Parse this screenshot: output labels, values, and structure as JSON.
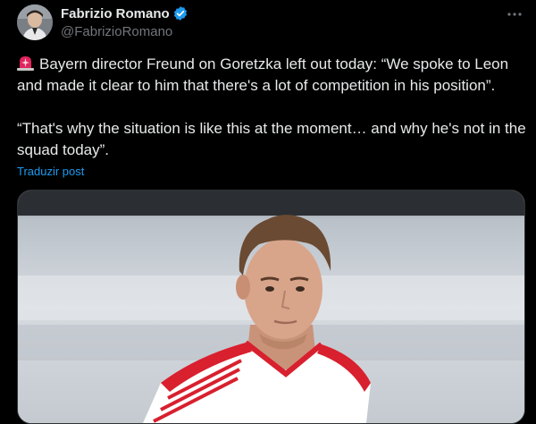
{
  "author": {
    "name": "Fabrizio Romano",
    "handle": "@FabrizioRomano",
    "verified_icon": "verified-badge-icon",
    "avatar_icon": "avatar"
  },
  "more_icon": "more-options-icon",
  "tweet": {
    "emoji": "rotating-light-emoji",
    "paragraph1": "Bayern director Freund on Goretzka left out today: “We spoke to Leon and made it clear to him that there's a lot of competition in his position”.",
    "paragraph2": "“That's why the situation is like this at the moment… and why he's not in the squad today”."
  },
  "translate_label": "Traduzir post",
  "colors": {
    "background": "#000000",
    "text": "#e7e9ea",
    "muted": "#71767b",
    "link": "#1d9bf0",
    "verified": "#1d9bf0",
    "border": "#2f3336"
  },
  "media": {
    "type": "photo"
  }
}
